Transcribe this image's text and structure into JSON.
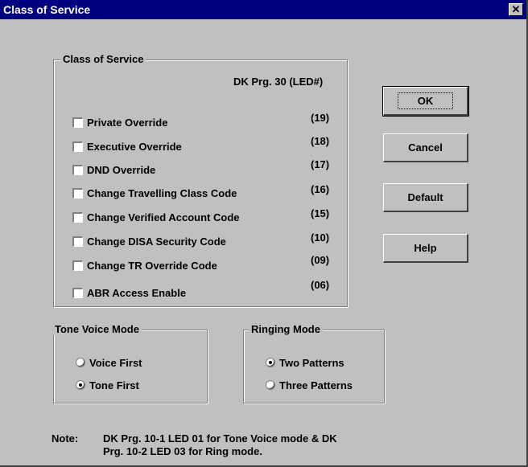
{
  "window": {
    "title": "Class of Service",
    "close_glyph": "✕"
  },
  "cos_group": {
    "legend": "Class of Service",
    "header": "DK Prg. 30  (LED#)",
    "items": [
      {
        "label": "Private Override",
        "led": "(19)",
        "checked": false
      },
      {
        "label": "Executive Override",
        "led": "(18)",
        "checked": false
      },
      {
        "label": "DND Override",
        "led": "(17)",
        "checked": false
      },
      {
        "label": "Change Travelling Class Code",
        "led": "(16)",
        "checked": false
      },
      {
        "label": "Change Verified Account Code",
        "led": "(15)",
        "checked": false
      },
      {
        "label": "Change DISA Security Code",
        "led": "(10)",
        "checked": false
      },
      {
        "label": "Change TR Override Code",
        "led": "(09)",
        "checked": false
      },
      {
        "label": "ABR Access  Enable",
        "led": "(06)",
        "checked": false
      }
    ]
  },
  "buttons": {
    "ok": "OK",
    "cancel": "Cancel",
    "default": "Default",
    "help": "Help"
  },
  "tone_voice": {
    "legend": "Tone Voice Mode",
    "options": [
      {
        "label": "Voice First",
        "selected": false
      },
      {
        "label": "Tone First",
        "selected": true
      }
    ]
  },
  "ringing": {
    "legend": "Ringing Mode",
    "options": [
      {
        "label": "Two Patterns",
        "selected": true
      },
      {
        "label": "Three Patterns",
        "selected": false
      }
    ]
  },
  "note": {
    "label": "Note:",
    "line1": "DK Prg. 10-1 LED 01 for Tone Voice mode & DK",
    "line2": "Prg. 10-2 LED 03 for Ring mode."
  }
}
